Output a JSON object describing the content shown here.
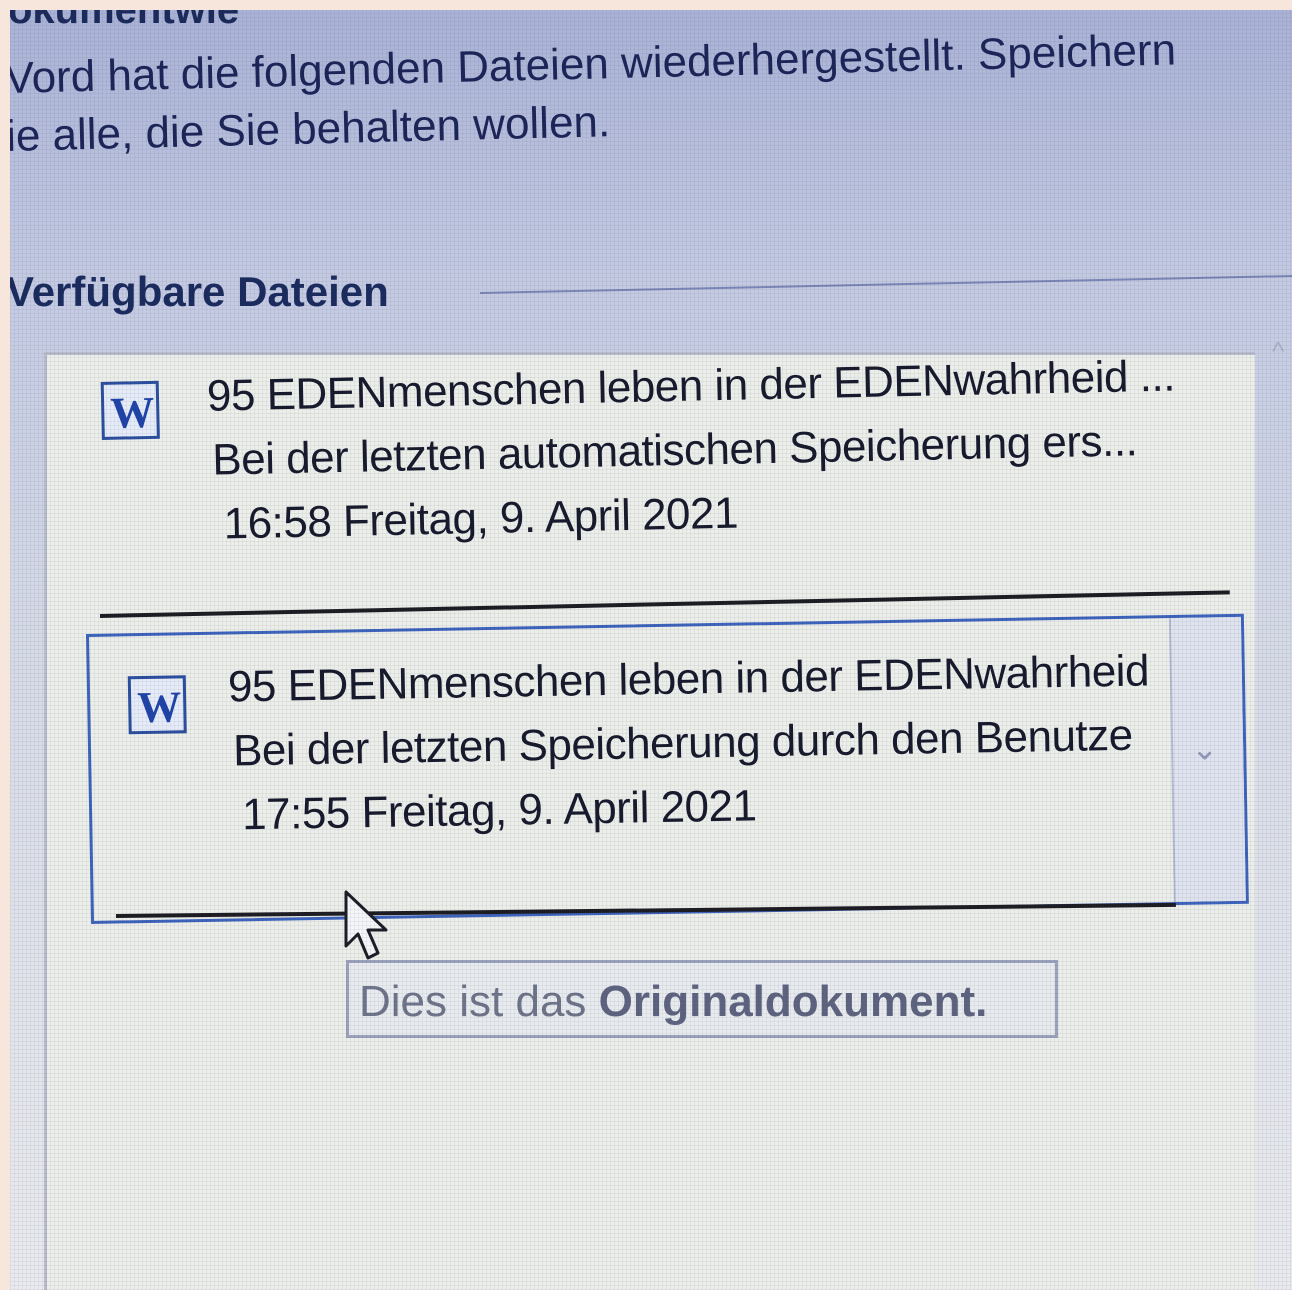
{
  "pane": {
    "title": "okumentwie",
    "intro_line1": "Vord hat die folgenden Dateien wiederhergestellt. Speichern",
    "intro_line2": "ie alle, die Sie behalten wollen.",
    "section_title": "Verfügbare Dateien"
  },
  "files": [
    {
      "icon": "word-document-icon",
      "name": "95 EDENmenschen leben in der EDENwahrheid ...",
      "status": "Bei der letzten automatischen Speicherung ers...",
      "timestamp": "16:58 Freitag, 9. April 2021"
    },
    {
      "icon": "word-document-icon",
      "name": "95 EDENmenschen leben in der EDENwahrheid",
      "status": "Bei der letzten Speicherung durch den Benutze",
      "timestamp": "17:55 Freitag, 9. April 2021",
      "selected": true
    }
  ],
  "tooltip": {
    "prefix": "Dies ist das ",
    "emphasis": "Originaldokument."
  },
  "icons": {
    "file": "W",
    "dropdown": "⌄",
    "scroll_up": "^"
  },
  "colors": {
    "accent": "#3d64bd",
    "word_blue": "#1f44a8",
    "title_text": "#1a2b5e"
  }
}
